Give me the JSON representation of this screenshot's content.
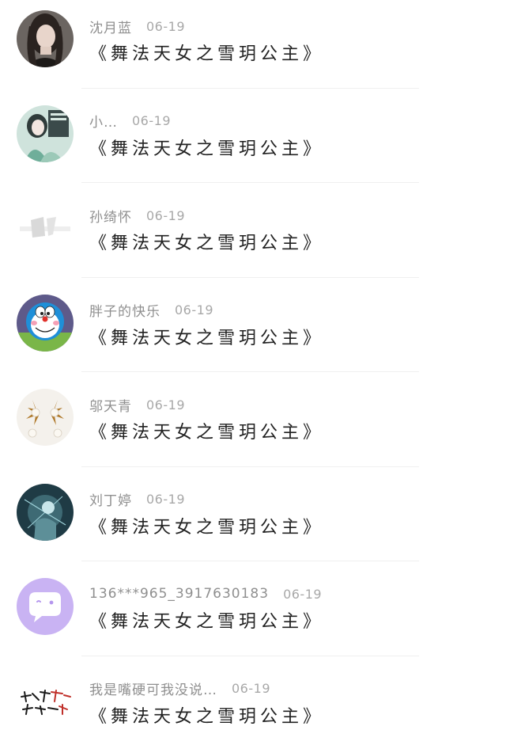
{
  "comments": [
    {
      "name": "沈月蓝",
      "date": "06-19",
      "text": "《舞法天女之雪玥公主》",
      "avatar": "photo-woman-dark-hair"
    },
    {
      "name": "小…",
      "date": "06-19",
      "text": "《舞法天女之雪玥公主》",
      "avatar": "anime-girl-green"
    },
    {
      "name": "孙绮怀",
      "date": "06-19",
      "text": "《舞法天女之雪玥公主》",
      "avatar": "faded-grey-icon"
    },
    {
      "name": "胖子的快乐",
      "date": "06-19",
      "text": "《舞法天女之雪玥公主》",
      "avatar": "doraemon"
    },
    {
      "name": "邬天青",
      "date": "06-19",
      "text": "《舞法天女之雪玥公主》",
      "avatar": "pearl-earrings"
    },
    {
      "name": "刘丁婷",
      "date": "06-19",
      "text": "《舞法天女之雪玥公主》",
      "avatar": "dark-teal-art"
    },
    {
      "name": "136***965_3917630183",
      "date": "06-19",
      "text": "《舞法天女之雪玥公主》",
      "avatar": "purple-chat-bubble"
    },
    {
      "name": "我是嘴硬可我没说…",
      "date": "06-19",
      "text": "《舞法天女之雪玥公主》",
      "avatar": "red-calligraphy"
    }
  ]
}
